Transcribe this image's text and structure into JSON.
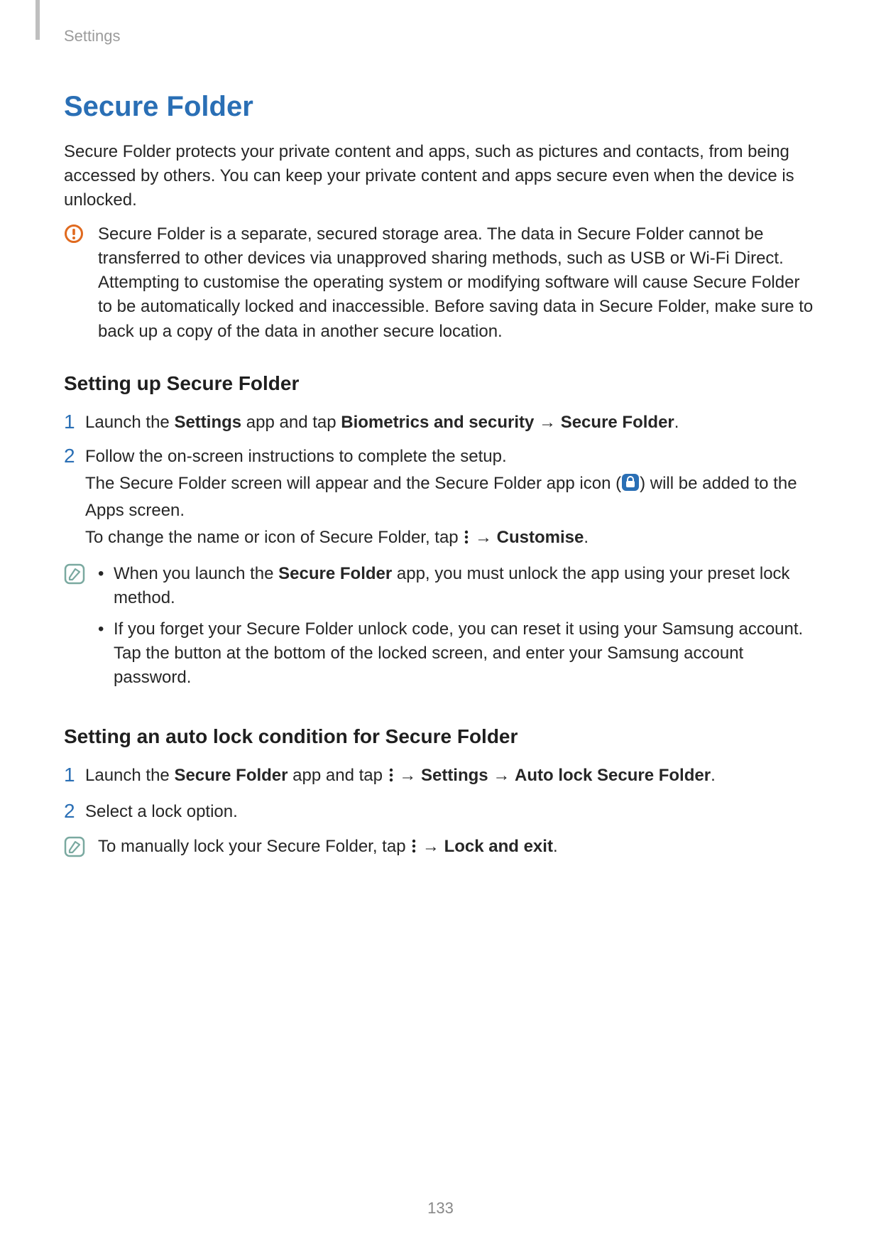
{
  "header": {
    "section": "Settings"
  },
  "title": "Secure Folder",
  "intro": "Secure Folder protects your private content and apps, such as pictures and contacts, from being accessed by others. You can keep your private content and apps secure even when the device is unlocked.",
  "caution_note": "Secure Folder is a separate, secured storage area. The data in Secure Folder cannot be transferred to other devices via unapproved sharing methods, such as USB or Wi-Fi Direct. Attempting to customise the operating system or modifying software will cause Secure Folder to be automatically locked and inaccessible. Before saving data in Secure Folder, make sure to back up a copy of the data in another secure location.",
  "section_a": {
    "heading": "Setting up Secure Folder",
    "step1": {
      "pre": "Launch the ",
      "b1": "Settings",
      "mid1": " app and tap ",
      "b2": "Biometrics and security",
      "arrow": " → ",
      "b3": "Secure Folder",
      "end": "."
    },
    "step2": {
      "line1": "Follow the on-screen instructions to complete the setup.",
      "line2_pre": "The Secure Folder screen will appear and the Secure Folder app icon (",
      "line2_post": ") will be added to the Apps screen.",
      "line3_pre": "To change the name or icon of Secure Folder, tap ",
      "line3_arrow": " → ",
      "line3_b": "Customise",
      "line3_end": "."
    },
    "note_bullets": {
      "b1_pre": "When you launch the ",
      "b1_bold": "Secure Folder",
      "b1_post": " app, you must unlock the app using your preset lock method.",
      "b2": "If you forget your Secure Folder unlock code, you can reset it using your Samsung account. Tap the button at the bottom of the locked screen, and enter your Samsung account password."
    }
  },
  "section_b": {
    "heading": "Setting an auto lock condition for Secure Folder",
    "step1": {
      "pre": "Launch the ",
      "b1": "Secure Folder",
      "mid": " app and tap ",
      "arrow1": " → ",
      "b2": "Settings",
      "arrow2": " → ",
      "b3": "Auto lock Secure Folder",
      "end": "."
    },
    "step2": "Select a lock option.",
    "note": {
      "pre": "To manually lock your Secure Folder, tap ",
      "arrow": " → ",
      "b": "Lock and exit",
      "end": "."
    }
  },
  "page_no": "133",
  "arrow_glyph": "→"
}
